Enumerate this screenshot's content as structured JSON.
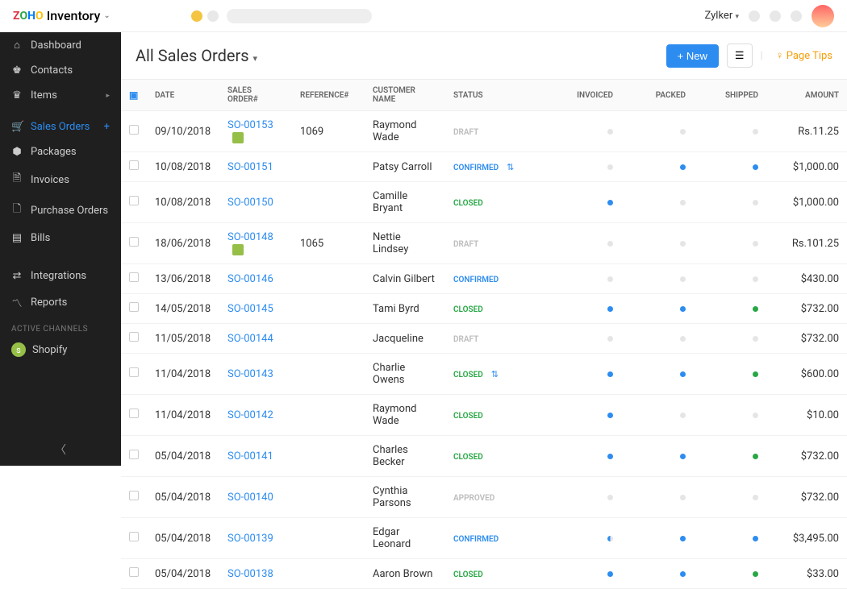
{
  "brand": {
    "app": "Inventory"
  },
  "top": {
    "org": "Zylker"
  },
  "sidebar": {
    "items": [
      {
        "label": "Dashboard",
        "icon": "home-icon",
        "glyph": "⌂"
      },
      {
        "label": "Contacts",
        "icon": "contacts-icon",
        "glyph": "♚"
      },
      {
        "label": "Items",
        "icon": "items-icon",
        "glyph": "♛",
        "sub": true
      },
      {
        "label": "Sales Orders",
        "icon": "cart-icon",
        "glyph": "🛒",
        "active": true,
        "plus": true
      },
      {
        "label": "Packages",
        "icon": "packages-icon",
        "glyph": "⬢"
      },
      {
        "label": "Invoices",
        "icon": "invoices-icon",
        "glyph": "🗎"
      },
      {
        "label": "Purchase Orders",
        "icon": "purchase-orders-icon",
        "glyph": "🗋"
      },
      {
        "label": "Bills",
        "icon": "bills-icon",
        "glyph": "▤"
      },
      {
        "label": "Integrations",
        "icon": "integrations-icon",
        "glyph": "⇄"
      },
      {
        "label": "Reports",
        "icon": "reports-icon",
        "glyph": "〽"
      }
    ],
    "section": "ACTIVE CHANNELS",
    "channel": {
      "label": "Shopify"
    }
  },
  "header": {
    "title": "All Sales Orders",
    "new": "New",
    "tips": "Page Tips"
  },
  "columns": {
    "date": "DATE",
    "so": "SALES ORDER#",
    "ref": "REFERENCE#",
    "cust": "CUSTOMER NAME",
    "status": "STATUS",
    "inv": "INVOICED",
    "packed": "PACKED",
    "shipped": "SHIPPED",
    "amt": "AMOUNT"
  },
  "rows": [
    {
      "date": "09/10/2018",
      "so": "SO-00153",
      "shop": true,
      "ref": "1069",
      "cust": "Raymond Wade",
      "status": "DRAFT",
      "inv": "grey",
      "packed": "grey",
      "shipped": "grey",
      "amt": "Rs.11.25"
    },
    {
      "date": "10/08/2018",
      "so": "SO-00151",
      "cust": "Patsy Carroll",
      "status": "CONFIRMED",
      "flag": true,
      "inv": "grey",
      "packed": "blue",
      "shipped": "blue",
      "amt": "$1,000.00"
    },
    {
      "date": "10/08/2018",
      "so": "SO-00150",
      "cust": "Camille Bryant",
      "status": "CLOSED",
      "inv": "blue",
      "packed": "grey",
      "shipped": "grey",
      "amt": "$1,000.00"
    },
    {
      "date": "18/06/2018",
      "so": "SO-00148",
      "shop": true,
      "ref": "1065",
      "cust": "Nettie Lindsey",
      "status": "DRAFT",
      "inv": "grey",
      "packed": "grey",
      "shipped": "grey",
      "amt": "Rs.101.25"
    },
    {
      "date": "13/06/2018",
      "so": "SO-00146",
      "cust": "Calvin Gilbert",
      "status": "CONFIRMED",
      "inv": "grey",
      "packed": "grey",
      "shipped": "grey",
      "amt": "$430.00"
    },
    {
      "date": "14/05/2018",
      "so": "SO-00145",
      "cust": "Tami Byrd",
      "status": "CLOSED",
      "inv": "blue",
      "packed": "blue",
      "shipped": "green",
      "amt": "$732.00"
    },
    {
      "date": "11/05/2018",
      "so": "SO-00144",
      "cust": "Jacqueline",
      "status": "DRAFT",
      "inv": "grey",
      "packed": "grey",
      "shipped": "grey",
      "amt": "$732.00"
    },
    {
      "date": "11/04/2018",
      "so": "SO-00143",
      "cust": "Charlie Owens",
      "status": "CLOSED",
      "flag": true,
      "inv": "blue",
      "packed": "blue",
      "shipped": "green",
      "amt": "$600.00"
    },
    {
      "date": "11/04/2018",
      "so": "SO-00142",
      "cust": "Raymond Wade",
      "status": "CLOSED",
      "inv": "blue",
      "packed": "grey",
      "shipped": "grey",
      "amt": "$10.00"
    },
    {
      "date": "05/04/2018",
      "so": "SO-00141",
      "cust": "Charles Becker",
      "status": "CLOSED",
      "inv": "blue",
      "packed": "blue",
      "shipped": "green",
      "amt": "$732.00"
    },
    {
      "date": "05/04/2018",
      "so": "SO-00140",
      "cust": "Cynthia Parsons",
      "status": "APPROVED",
      "inv": "grey",
      "packed": "grey",
      "shipped": "grey",
      "amt": "$732.00"
    },
    {
      "date": "05/04/2018",
      "so": "SO-00139",
      "cust": "Edgar Leonard",
      "status": "CONFIRMED",
      "inv": "half",
      "packed": "blue",
      "shipped": "blue",
      "amt": "$3,495.00"
    },
    {
      "date": "05/04/2018",
      "so": "SO-00138",
      "cust": "Aaron Brown",
      "status": "CLOSED",
      "inv": "blue",
      "packed": "blue",
      "shipped": "green",
      "amt": "$33.00"
    }
  ]
}
